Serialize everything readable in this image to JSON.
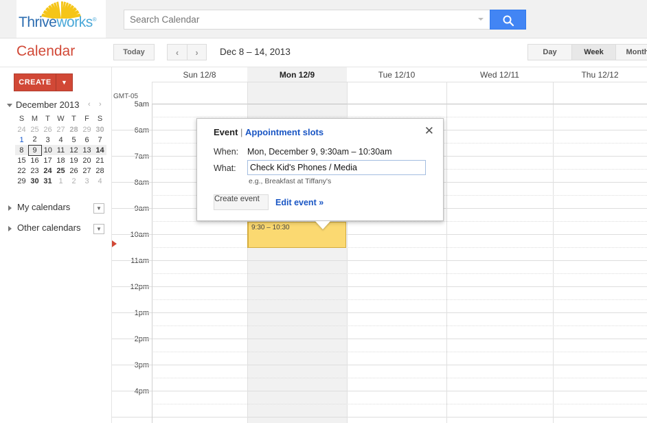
{
  "brand": {
    "name_part1": "Thrive",
    "name_part2": "works",
    "registered": "®",
    "sun_icon": "sunburst-icon"
  },
  "search": {
    "placeholder": "Search Calendar",
    "value": "",
    "dropdown_icon": "chevron-down-icon",
    "button_icon": "search-icon"
  },
  "header": {
    "title": "Calendar",
    "today_label": "Today",
    "prev_icon": "‹",
    "next_icon": "›",
    "date_range": "Dec 8 – 14, 2013",
    "views": [
      {
        "label": "Day",
        "active": false
      },
      {
        "label": "Week",
        "active": true
      },
      {
        "label": "Month",
        "active": false
      }
    ]
  },
  "sidebar": {
    "create_label": "CREATE",
    "create_arrow": "▼",
    "mini_calendar": {
      "month_label": "December 2013",
      "collapse_icon": "triangle-down-icon",
      "prev_icon": "‹",
      "next_icon": "›",
      "weekday_headers": [
        "S",
        "M",
        "T",
        "W",
        "T",
        "F",
        "S"
      ],
      "weeks": [
        [
          {
            "d": "24",
            "cls": "out"
          },
          {
            "d": "25",
            "cls": "out"
          },
          {
            "d": "26",
            "cls": "out"
          },
          {
            "d": "27",
            "cls": "out"
          },
          {
            "d": "28",
            "cls": "out bold"
          },
          {
            "d": "29",
            "cls": "out"
          },
          {
            "d": "30",
            "cls": "out bold"
          }
        ],
        [
          {
            "d": "1",
            "cls": "blue"
          },
          {
            "d": "2",
            "cls": ""
          },
          {
            "d": "3",
            "cls": ""
          },
          {
            "d": "4",
            "cls": ""
          },
          {
            "d": "5",
            "cls": ""
          },
          {
            "d": "6",
            "cls": ""
          },
          {
            "d": "7",
            "cls": ""
          }
        ],
        [
          {
            "d": "8",
            "cls": ""
          },
          {
            "d": "9",
            "cls": "today-box"
          },
          {
            "d": "10",
            "cls": ""
          },
          {
            "d": "11",
            "cls": ""
          },
          {
            "d": "12",
            "cls": ""
          },
          {
            "d": "13",
            "cls": ""
          },
          {
            "d": "14",
            "cls": "bold"
          }
        ],
        [
          {
            "d": "15",
            "cls": ""
          },
          {
            "d": "16",
            "cls": ""
          },
          {
            "d": "17",
            "cls": ""
          },
          {
            "d": "18",
            "cls": ""
          },
          {
            "d": "19",
            "cls": ""
          },
          {
            "d": "20",
            "cls": ""
          },
          {
            "d": "21",
            "cls": ""
          }
        ],
        [
          {
            "d": "22",
            "cls": ""
          },
          {
            "d": "23",
            "cls": ""
          },
          {
            "d": "24",
            "cls": "bold"
          },
          {
            "d": "25",
            "cls": "bold"
          },
          {
            "d": "26",
            "cls": ""
          },
          {
            "d": "27",
            "cls": ""
          },
          {
            "d": "28",
            "cls": ""
          }
        ],
        [
          {
            "d": "29",
            "cls": ""
          },
          {
            "d": "30",
            "cls": "bold"
          },
          {
            "d": "31",
            "cls": "bold"
          },
          {
            "d": "1",
            "cls": "out"
          },
          {
            "d": "2",
            "cls": "out"
          },
          {
            "d": "3",
            "cls": "out"
          },
          {
            "d": "4",
            "cls": "out"
          }
        ]
      ],
      "highlighted_week_index": 2
    },
    "sections": [
      {
        "label": "My calendars",
        "expand_icon": "triangle-right-icon",
        "dropdown_icon": "▼"
      },
      {
        "label": "Other calendars",
        "expand_icon": "triangle-right-icon",
        "dropdown_icon": "▼"
      }
    ]
  },
  "grid": {
    "timezone_label": "GMT-05",
    "days": [
      {
        "label": "Sun 12/8",
        "selected": false
      },
      {
        "label": "Mon 12/9",
        "selected": true
      },
      {
        "label": "Tue 12/10",
        "selected": false
      },
      {
        "label": "Wed 12/11",
        "selected": false
      },
      {
        "label": "Thu 12/12",
        "selected": false
      }
    ],
    "hours": [
      "5am",
      "6am",
      "7am",
      "8am",
      "9am",
      "10am",
      "11am",
      "12pm",
      "1pm",
      "2pm",
      "3pm",
      "4pm"
    ],
    "now_marker": "current-time-marker"
  },
  "event": {
    "time_label": "9:30 – 10:30",
    "color": "#fbd971",
    "border_color": "#d4ac3c"
  },
  "popup": {
    "title_main": "Event",
    "title_sep": " | ",
    "title_link": "Appointment slots",
    "close_icon": "✕",
    "when_label": "When:",
    "when_value": "Mon, December 9, 9:30am – 10:30am",
    "what_label": "What:",
    "what_value": "Check Kid's Phones / Media",
    "what_placeholder": "",
    "hint": "e.g., Breakfast at Tiffany's",
    "create_label": "Create event",
    "edit_label": "Edit event »"
  },
  "colors": {
    "brand_red": "#d14836",
    "link_blue": "#1a56c4",
    "search_blue": "#4285f4",
    "event_yellow": "#fbd971"
  }
}
